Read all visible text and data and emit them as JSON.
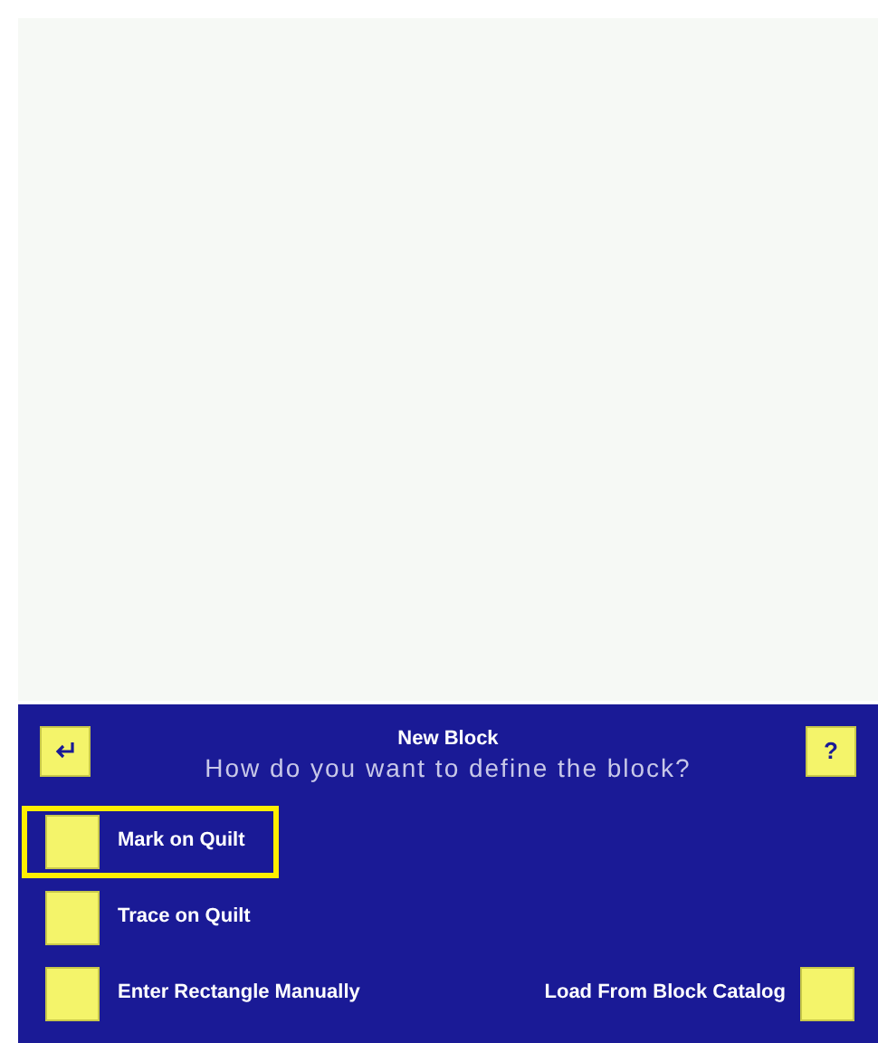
{
  "panel": {
    "title": "New Block",
    "prompt": "How do you want to define the block?",
    "help": "?"
  },
  "options": [
    {
      "label": "Mark on Quilt",
      "selected": true,
      "kind": "leading"
    },
    {
      "label": "Trace on Quilt",
      "selected": false,
      "kind": "leading"
    },
    {
      "label": "Enter Rectangle Manually",
      "selected": false,
      "kind": "leading"
    },
    {
      "label": "Load From Block Catalog",
      "selected": false,
      "kind": "trailing"
    }
  ]
}
